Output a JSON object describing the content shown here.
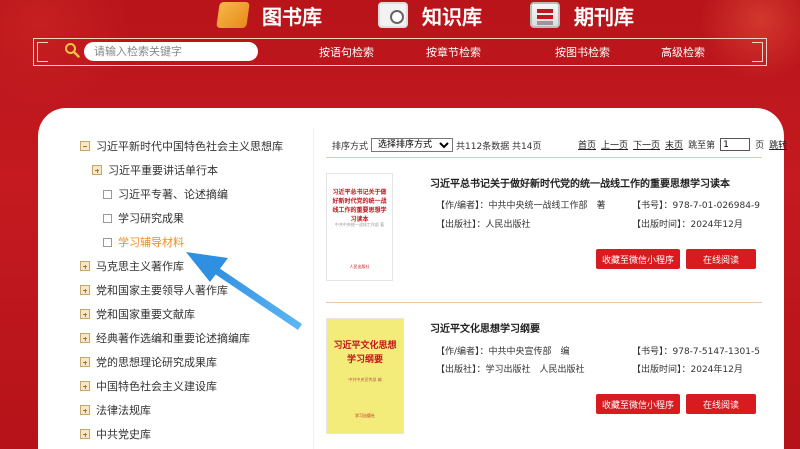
{
  "nav": {
    "library": "图书库",
    "knowledge": "知识库",
    "journal": "期刊库"
  },
  "search": {
    "placeholder": "请输入检索关键字",
    "by_sentence": "按语句检索",
    "by_chapter": "按章节检索",
    "by_book": "按图书检索",
    "advanced": "高级检索"
  },
  "sidebar": {
    "items": [
      {
        "label": "习近平新时代中国特色社会主义思想库",
        "type": "minus"
      },
      {
        "label": "习近平重要讲话单行本",
        "type": "plus"
      },
      {
        "label": "习近平专著、论述摘编",
        "type": "check"
      },
      {
        "label": "学习研究成果",
        "type": "check"
      },
      {
        "label": "学习辅导材料",
        "type": "check",
        "active": true
      },
      {
        "label": "马克思主义著作库",
        "type": "plus"
      },
      {
        "label": "党和国家主要领导人著作库",
        "type": "plus"
      },
      {
        "label": "党和国家重要文献库",
        "type": "plus"
      },
      {
        "label": "经典著作选编和重要论述摘编库",
        "type": "plus"
      },
      {
        "label": "党的思想理论研究成果库",
        "type": "plus"
      },
      {
        "label": "中国特色社会主义建设库",
        "type": "plus"
      },
      {
        "label": "法律法规库",
        "type": "plus"
      },
      {
        "label": "中共党史库",
        "type": "plus"
      }
    ]
  },
  "toolbar": {
    "sort_label": "排序方式",
    "sort_value": "选择排序方式",
    "summary": "共112条数据 共14页",
    "first": "首页",
    "prev": "上一页",
    "next": "下一页",
    "last": "末页",
    "jump_label": "跳至第",
    "page_value": "1",
    "page_unit": "页",
    "jump": "跳转"
  },
  "books": [
    {
      "title": "习近平总书记关于做好新时代党的统一战线工作的重要思想学习读本",
      "author": "【作/编者】：中共中央统一战线工作部　著",
      "isbn": "【书号】：978-7-01-026984-9",
      "publisher": "【出版社】：人民出版社",
      "date": "【出版时间】：2024年12月",
      "cover_title": "习近平总书记关于做好新时代党的统一战线工作的重要思想学习读本",
      "cover_sub": "中共中央统一战线工作部 著",
      "cover_pub": "人民出版社",
      "btn_collect": "收藏至微信小程序",
      "btn_read": "在线阅读"
    },
    {
      "title": "习近平文化思想学习纲要",
      "author": "【作/编者】：中共中央宣传部　编",
      "isbn": "【书号】：978-7-5147-1301-5",
      "publisher": "【出版社】：学习出版社　人民出版社",
      "date": "【出版时间】：2024年12月",
      "cover_title": "习近平文化思想学习纲要",
      "cover_sub": "中共中央宣传部 编",
      "cover_pub": "学习出版社",
      "btn_collect": "收藏至微信小程序",
      "btn_read": "在线阅读"
    }
  ],
  "colors": {
    "brand_red": "#c0171d",
    "button_red": "#d81b1f",
    "active_orange": "#f08c1e",
    "arrow_blue": "#3a9be8"
  }
}
